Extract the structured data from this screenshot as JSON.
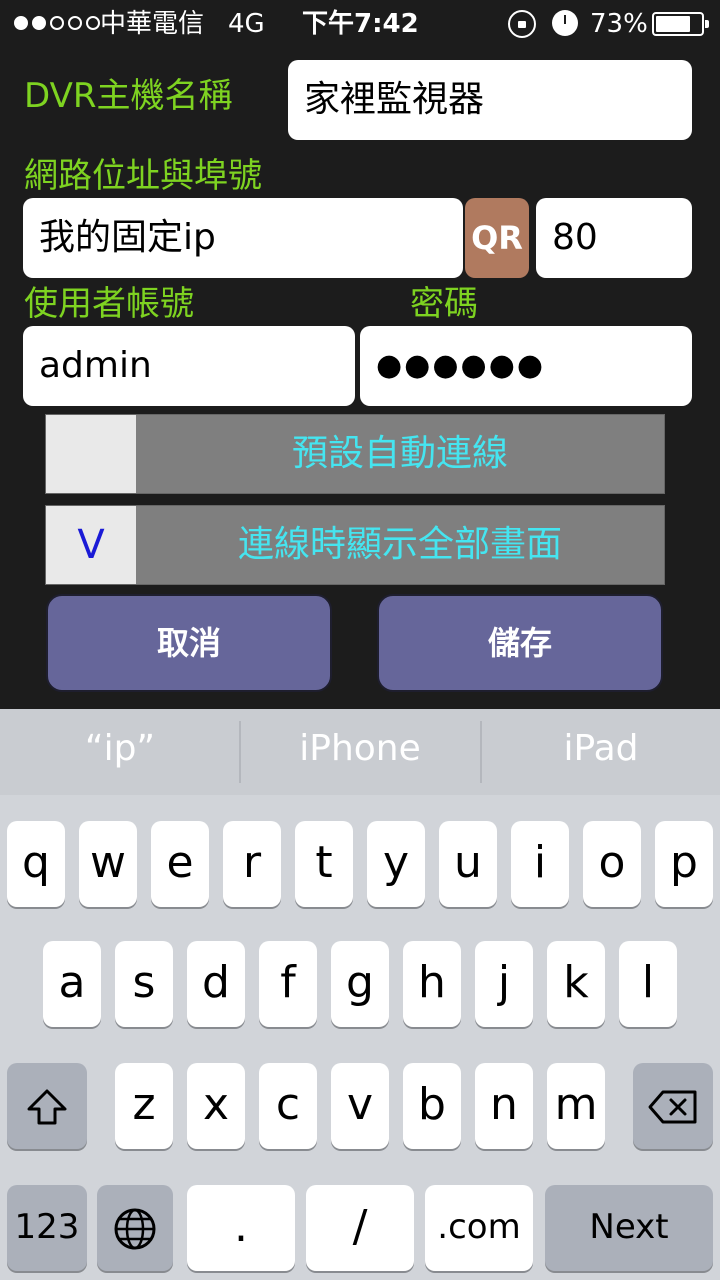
{
  "status_bar": {
    "carrier": "中華電信",
    "network": "4G",
    "time": "下午7:42",
    "battery": "73%",
    "signal_strength_of_5": 2
  },
  "form": {
    "dvr_name_label": "DVR主機名稱",
    "dvr_name_value": "家裡監視器",
    "address_label": "網路位址與埠號",
    "address_value": "我的固定ip",
    "qr_label": "QR",
    "port_value": "80",
    "username_label": "使用者帳號",
    "password_label": "密碼",
    "username_value": "admin",
    "password_value": "●●●●●●",
    "option_auto_connect": {
      "label": "預設自動連線",
      "check": ""
    },
    "option_fullscreen": {
      "label": "連線時顯示全部畫面",
      "check": "V"
    },
    "cancel_label": "取消",
    "save_label": "儲存"
  },
  "keyboard": {
    "suggestions": [
      "“ip”",
      "iPhone",
      "iPad"
    ],
    "row1": [
      "q",
      "w",
      "e",
      "r",
      "t",
      "y",
      "u",
      "i",
      "o",
      "p"
    ],
    "row2": [
      "a",
      "s",
      "d",
      "f",
      "g",
      "h",
      "j",
      "k",
      "l"
    ],
    "row3": [
      "z",
      "x",
      "c",
      "v",
      "b",
      "n",
      "m"
    ],
    "numbers_label": "123",
    "dot_label": ".",
    "slash_label": "/",
    "dotcom_label": ".com",
    "next_label": "Next"
  },
  "colors": {
    "label_green": "#7ed321",
    "option_text_cyan": "#45e5f0",
    "button_purple": "#66669a",
    "qr_brown": "#b07a5f"
  }
}
